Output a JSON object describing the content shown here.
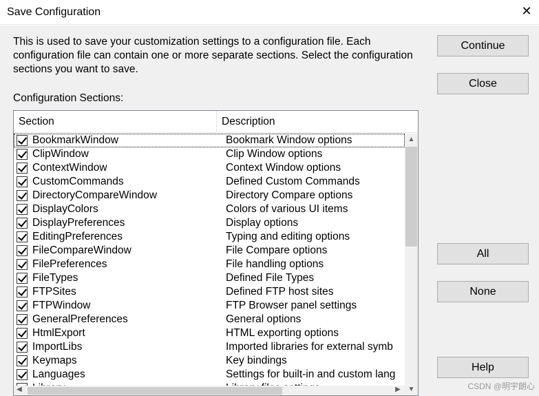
{
  "window": {
    "title": "Save Configuration",
    "close_glyph": "✕"
  },
  "description": "This is used to save your customization settings to a configuration file. Each configuration file can contain one or more separate sections. Select the configuration sections you want to save.",
  "sections_label": "Configuration Sections:",
  "table": {
    "columns": [
      "Section",
      "Description"
    ],
    "rows": [
      {
        "section": "BookmarkWindow",
        "description": "Bookmark Window options",
        "checked": true
      },
      {
        "section": "ClipWindow",
        "description": "Clip Window options",
        "checked": true
      },
      {
        "section": "ContextWindow",
        "description": "Context Window options",
        "checked": true
      },
      {
        "section": "CustomCommands",
        "description": "Defined Custom Commands",
        "checked": true
      },
      {
        "section": "DirectoryCompareWindow",
        "description": "Directory Compare options",
        "checked": true
      },
      {
        "section": "DisplayColors",
        "description": "Colors of various UI items",
        "checked": true
      },
      {
        "section": "DisplayPreferences",
        "description": "Display options",
        "checked": true
      },
      {
        "section": "EditingPreferences",
        "description": "Typing and editing options",
        "checked": true
      },
      {
        "section": "FileCompareWindow",
        "description": "File Compare options",
        "checked": true
      },
      {
        "section": "FilePreferences",
        "description": "File handling options",
        "checked": true
      },
      {
        "section": "FileTypes",
        "description": "Defined File Types",
        "checked": true
      },
      {
        "section": "FTPSites",
        "description": "Defined FTP host sites",
        "checked": true
      },
      {
        "section": "FTPWindow",
        "description": "FTP Browser panel settings",
        "checked": true
      },
      {
        "section": "GeneralPreferences",
        "description": "General options",
        "checked": true
      },
      {
        "section": "HtmlExport",
        "description": "HTML exporting options",
        "checked": true
      },
      {
        "section": "ImportLibs",
        "description": "Imported libraries for external symb",
        "checked": true
      },
      {
        "section": "Keymaps",
        "description": "Key bindings",
        "checked": true
      },
      {
        "section": "Languages",
        "description": "Settings for built-in and custom lang",
        "checked": true
      },
      {
        "section": "Library",
        "description": "Library files settings",
        "checked": true
      }
    ]
  },
  "buttons": {
    "continue": "Continue",
    "close": "Close",
    "all": "All",
    "none": "None",
    "help": "Help"
  },
  "watermark": "CSDN @明宇朗心"
}
